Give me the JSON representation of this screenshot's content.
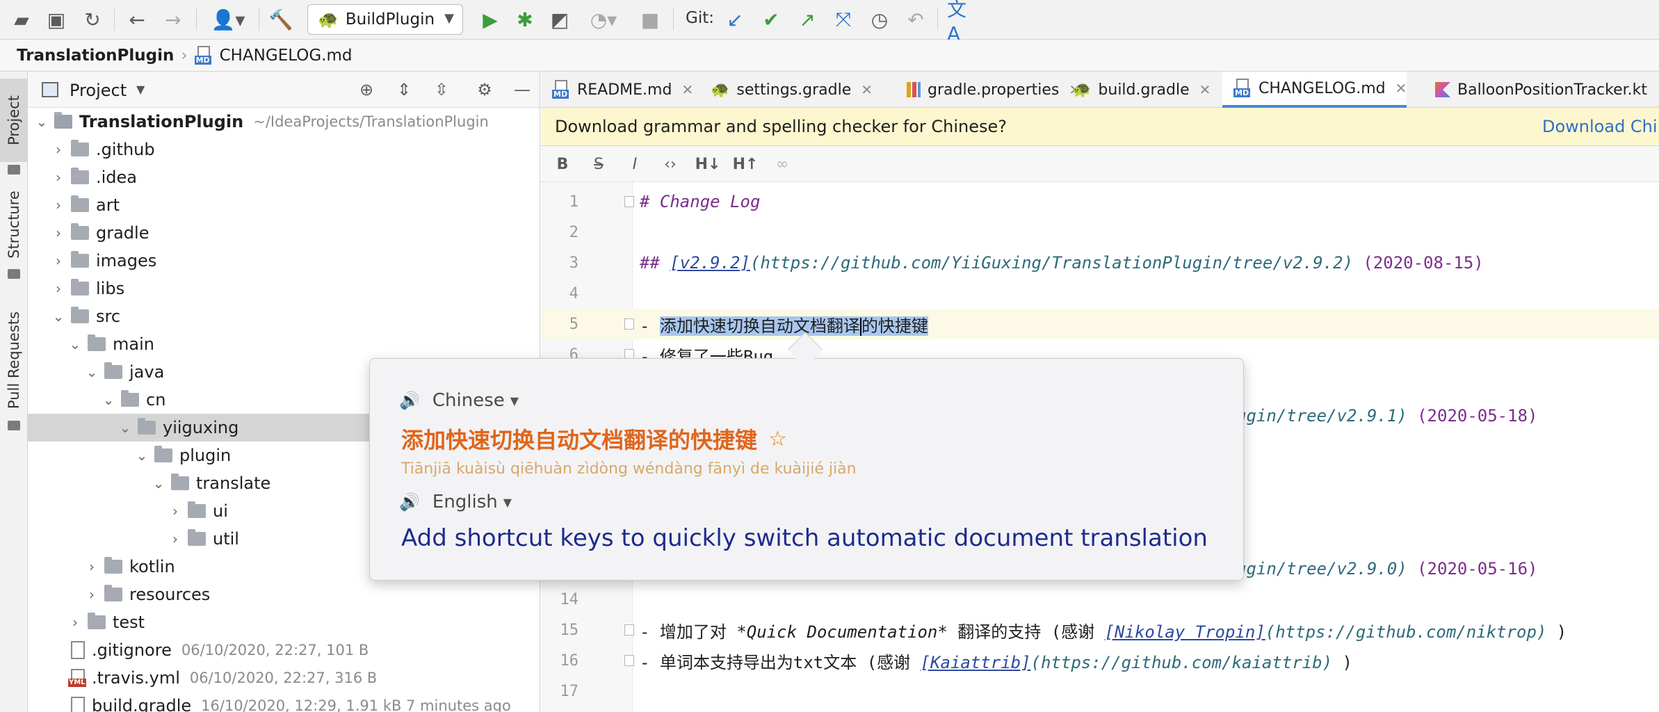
{
  "toolbar": {
    "run_config": "BuildPlugin",
    "git_label": "Git:"
  },
  "breadcrumb": {
    "project": "TranslationPlugin",
    "file": "CHANGELOG.md"
  },
  "left_strip": {
    "tabs": [
      "Project",
      "Structure",
      "Pull Requests"
    ]
  },
  "project_panel": {
    "title": "Project",
    "tree": [
      {
        "name": "TranslationPlugin",
        "meta": "~/IdeaProjects/TranslationPlugin",
        "depth": 0,
        "expanded": true,
        "kind": "module"
      },
      {
        "name": ".github",
        "depth": 1,
        "expanded": false,
        "kind": "folder"
      },
      {
        "name": ".idea",
        "depth": 1,
        "expanded": false,
        "kind": "folder"
      },
      {
        "name": "art",
        "depth": 1,
        "expanded": false,
        "kind": "folder"
      },
      {
        "name": "gradle",
        "depth": 1,
        "expanded": false,
        "kind": "folder"
      },
      {
        "name": "images",
        "depth": 1,
        "expanded": false,
        "kind": "folder"
      },
      {
        "name": "libs",
        "depth": 1,
        "expanded": false,
        "kind": "folder"
      },
      {
        "name": "src",
        "depth": 1,
        "expanded": true,
        "kind": "folder"
      },
      {
        "name": "main",
        "depth": 2,
        "expanded": true,
        "kind": "folder"
      },
      {
        "name": "java",
        "depth": 3,
        "expanded": true,
        "kind": "folder"
      },
      {
        "name": "cn",
        "depth": 4,
        "expanded": true,
        "kind": "folder"
      },
      {
        "name": "yiiguxing",
        "depth": 5,
        "expanded": true,
        "kind": "folder",
        "selected": true
      },
      {
        "name": "plugin",
        "depth": 6,
        "expanded": true,
        "kind": "folder"
      },
      {
        "name": "translate",
        "depth": 7,
        "expanded": true,
        "kind": "folder"
      },
      {
        "name": "ui",
        "depth": 8,
        "expanded": false,
        "kind": "folder"
      },
      {
        "name": "util",
        "depth": 8,
        "expanded": false,
        "kind": "folder"
      },
      {
        "name": "kotlin",
        "depth": 3,
        "expanded": false,
        "kind": "folder"
      },
      {
        "name": "resources",
        "depth": 3,
        "expanded": false,
        "kind": "folder"
      },
      {
        "name": "test",
        "depth": 2,
        "expanded": false,
        "kind": "folder"
      },
      {
        "name": ".gitignore",
        "meta": "06/10/2020, 22:27, 101 B",
        "depth": 1,
        "kind": "file"
      },
      {
        "name": ".travis.yml",
        "meta": "06/10/2020, 22:27, 316 B",
        "depth": 1,
        "kind": "yml"
      },
      {
        "name": "build.gradle",
        "meta": "16/10/2020, 12:29, 1.91 kB 7 minutes ago",
        "depth": 1,
        "kind": "gradle"
      }
    ]
  },
  "editor": {
    "tabs": [
      {
        "label": "README.md",
        "icon": "md"
      },
      {
        "label": "settings.gradle",
        "icon": "gradle"
      },
      {
        "label": "gradle.properties",
        "icon": "props"
      },
      {
        "label": "build.gradle",
        "icon": "gradle"
      },
      {
        "label": "CHANGELOG.md",
        "icon": "md",
        "active": true
      },
      {
        "label": "BalloonPositionTracker.kt",
        "icon": "kt"
      }
    ],
    "banner": {
      "message": "Download grammar and spelling checker for Chinese?",
      "link": "Download Chi"
    },
    "lines": {
      "l1": "# Change Log",
      "l3_hash": "## ",
      "l3_link": "[v2.9.2]",
      "l3_url": "(https://github.com/YiiGuxing/TranslationPlugin/tree/v2.9.2)",
      "l3_date": " (2020-08-15)",
      "l5_dash": "- ",
      "l5_sel_a": "添加快速切换自动文档翻译",
      "l5_sel_b": "的快捷键",
      "l6": "- 修复了一些Bug",
      "l8_url": "ugin/tree/v2.9.1)",
      "l8_date": " (2020-05-18)",
      "l13_url": "ugin/tree/v2.9.0)",
      "l13_date": " (2020-05-16)",
      "l15_a": "- 增加了对 ",
      "l15_em": "*Quick Documentation*",
      "l15_b": " 翻译的支持 (感谢 ",
      "l15_link": "[Nikolay Tropin]",
      "l15_url": "(https://github.com/niktrop)",
      "l15_c": " )",
      "l16_a": "- 单词本支持导出为txt文本 (感谢 ",
      "l16_link": "[Kaiattrib]",
      "l16_url": "(https://github.com/kaiattrib)",
      "l16_c": " )"
    }
  },
  "popup": {
    "source_lang": "Chinese",
    "source_text": "添加快速切换自动文档翻译的快捷键",
    "pinyin": "Tiānjiā kuàisù qiēhuàn zìdòng wéndàng fānyì de kuàijié jiàn",
    "target_lang": "English",
    "target_text": "Add shortcut keys to quickly switch automatic document translation"
  }
}
